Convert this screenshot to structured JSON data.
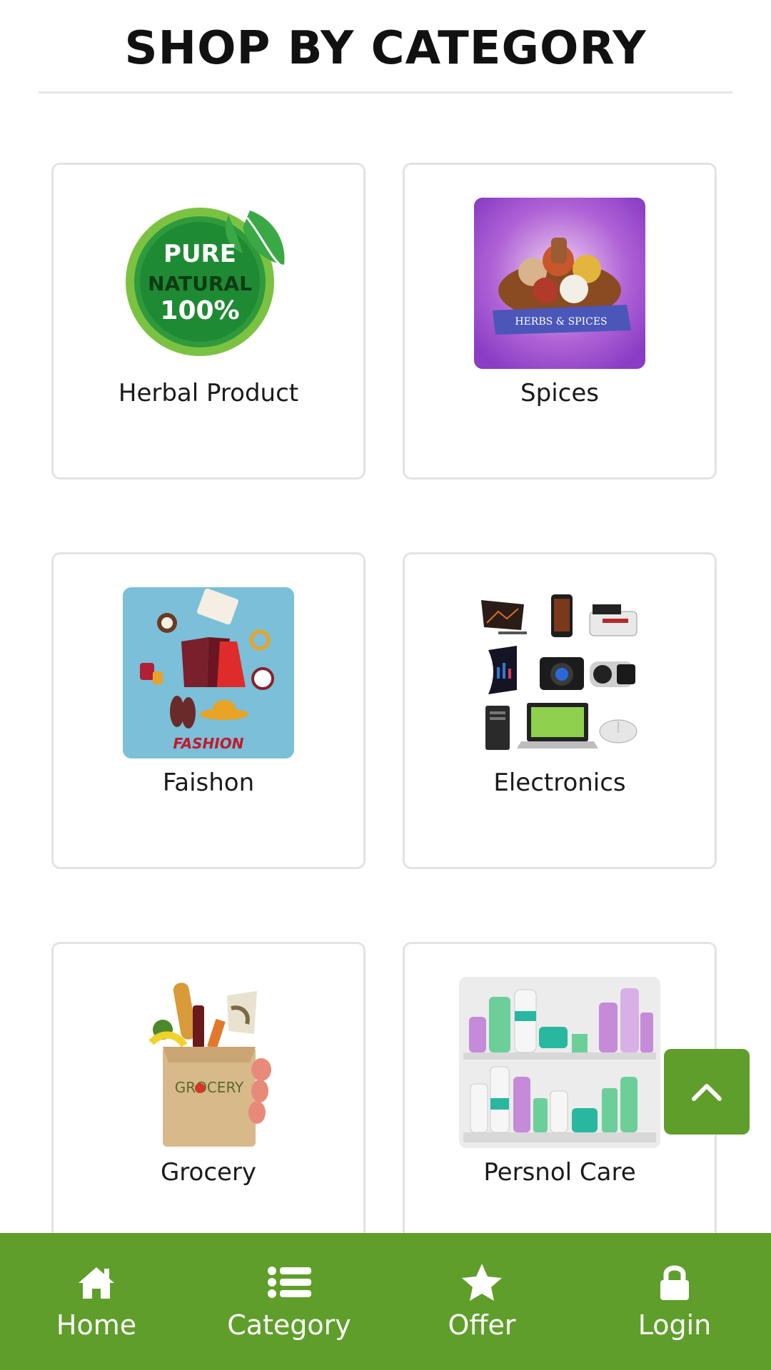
{
  "header": {
    "title": "SHOP BY CATEGORY"
  },
  "categories": [
    {
      "label": "Herbal Product",
      "image_text": [
        "PURE",
        "NATURAL",
        "100%"
      ]
    },
    {
      "label": "Spices",
      "image_text": "HERBS & SPICES"
    },
    {
      "label": "Faishon",
      "image_text": "FASHION"
    },
    {
      "label": "Electronics"
    },
    {
      "label": "Grocery",
      "image_text": "GROCERY"
    },
    {
      "label": "Persnol Care"
    }
  ],
  "bottom_nav": [
    {
      "label": "Home",
      "icon": "home-icon"
    },
    {
      "label": "Category",
      "icon": "list-icon"
    },
    {
      "label": "Offer",
      "icon": "star-icon"
    },
    {
      "label": "Login",
      "icon": "lock-icon"
    }
  ],
  "colors": {
    "brand_green": "#5f9e2a",
    "card_border": "#e3e3e3"
  }
}
